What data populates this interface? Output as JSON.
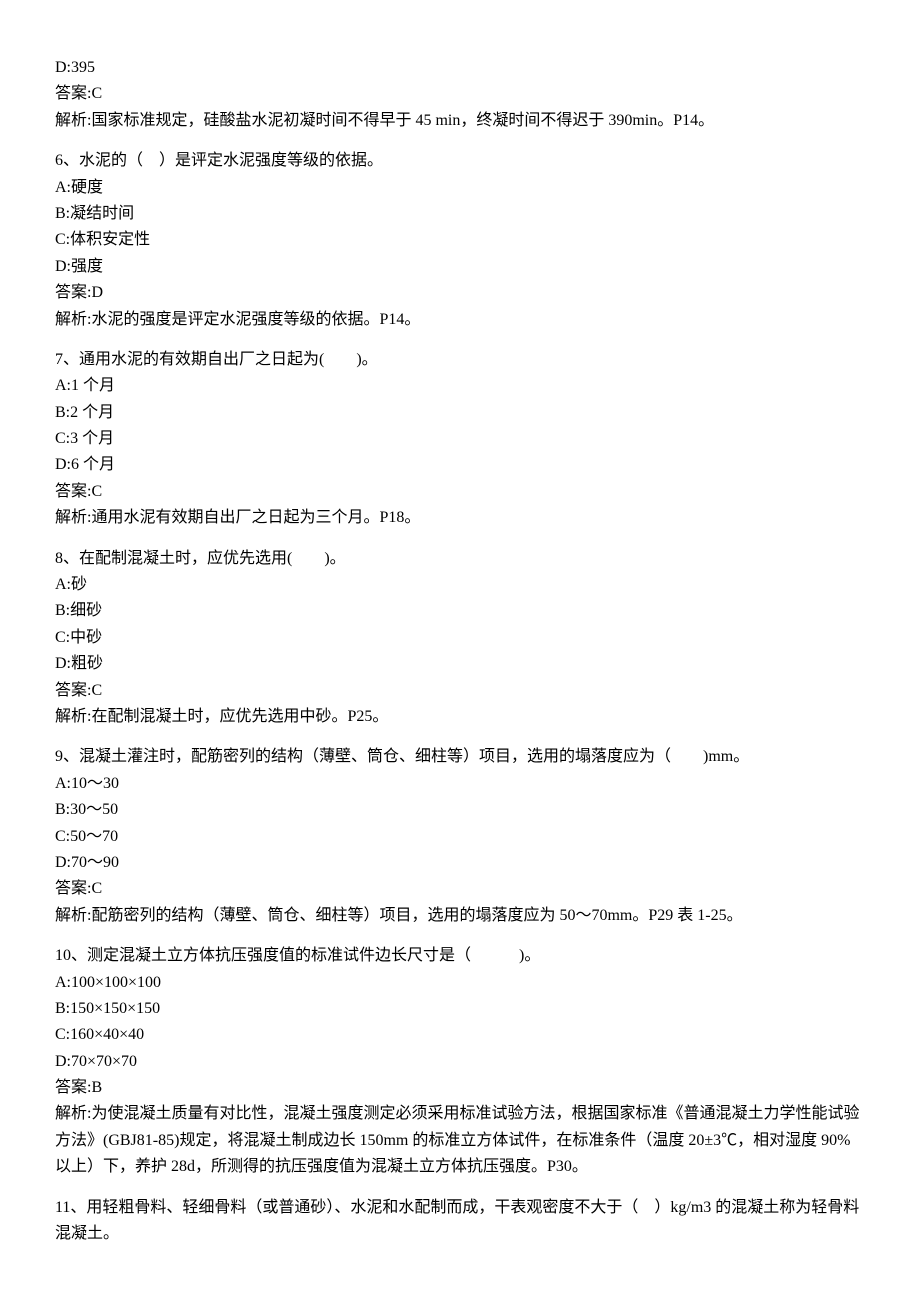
{
  "q5": {
    "optionD": "D:395",
    "answer": "答案:C",
    "explain": "解析:国家标准规定，硅酸盐水泥初凝时间不得早于 45 min，终凝时间不得迟于 390min。P14。"
  },
  "q6": {
    "stem": "6、水泥的（　）是评定水泥强度等级的依据。",
    "a": "A:硬度",
    "b": "B:凝结时间",
    "c": "C:体积安定性",
    "d": "D:强度",
    "answer": "答案:D",
    "explain": "解析:水泥的强度是评定水泥强度等级的依据。P14。"
  },
  "q7": {
    "stem": "7、通用水泥的有效期自出厂之日起为(　　)。",
    "a": "A:1 个月",
    "b": "B:2 个月",
    "c": "C:3 个月",
    "d": "D:6 个月",
    "answer": "答案:C",
    "explain": "解析:通用水泥有效期自出厂之日起为三个月。P18。"
  },
  "q8": {
    "stem": "8、在配制混凝土时，应优先选用(　　)。",
    "a": "A:砂",
    "b": "B:细砂",
    "c": "C:中砂",
    "d": "D:粗砂",
    "answer": "答案:C",
    "explain": "解析:在配制混凝土时，应优先选用中砂。P25。"
  },
  "q9": {
    "stem": "9、混凝土灌注时，配筋密列的结构（薄壁、筒仓、细柱等）项目，选用的塌落度应为（　　)mm。",
    "a": "A:10～30",
    "b": "B:30～50",
    "c": "C:50～70",
    "d": "D:70～90",
    "answer": "答案:C",
    "explain": "解析:配筋密列的结构（薄壁、筒仓、细柱等）项目，选用的塌落度应为 50～70mm。P29 表 1-25。"
  },
  "q10": {
    "stem": "10、测定混凝土立方体抗压强度值的标准试件边长尺寸是（　　　)。",
    "a": "A:100×100×100",
    "b": "B:150×150×150",
    "c": "C:160×40×40",
    "d": "D:70×70×70",
    "answer": "答案:B",
    "explain": "解析:为使混凝土质量有对比性，混凝土强度测定必须采用标准试验方法，根据国家标准《普通混凝土力学性能试验方法》(GBJ81-85)规定，将混凝土制成边长 150mm 的标准立方体试件，在标准条件（温度 20±3℃，相对湿度 90%以上）下，养护 28d，所测得的抗压强度值为混凝土立方体抗压强度。P30。"
  },
  "q11": {
    "stem": "11、用轻粗骨料、轻细骨料（或普通砂）、水泥和水配制而成，干表观密度不大于（　）kg/m3 的混凝土称为轻骨料混凝土。"
  }
}
